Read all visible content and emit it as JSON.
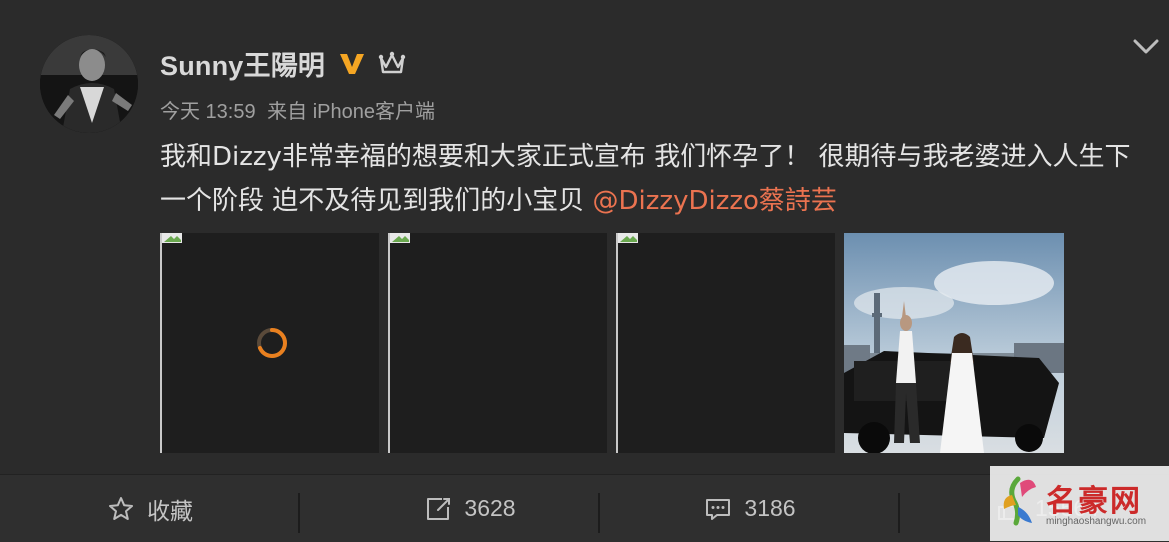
{
  "post": {
    "user": {
      "name": "Sunny王陽明"
    },
    "meta": {
      "time": "今天 13:59",
      "source": "来自 iPhone客户端"
    },
    "content": {
      "text": "我和Dizzy非常幸福的想要和大家正式宣布 我们怀孕了！ 很期待与我老婆进入人生下一个阶段 迫不及待见到我们的小宝贝 ",
      "mention": "@DizzyDizzo蔡詩芸"
    },
    "images": [
      {
        "state": "loading"
      },
      {
        "state": "broken"
      },
      {
        "state": "broken"
      },
      {
        "state": "photo"
      }
    ]
  },
  "actions": {
    "favorite_label": "收藏",
    "repost_count": "3628",
    "comment_count": "3186",
    "like_count": "15564"
  },
  "watermark": {
    "title": "名豪网",
    "url": "minghaoshangwu.com"
  },
  "colors": {
    "background": "#2b2b2b",
    "mention": "#eb7350",
    "verified": "#f5a623",
    "spinner": "#e9801f"
  }
}
